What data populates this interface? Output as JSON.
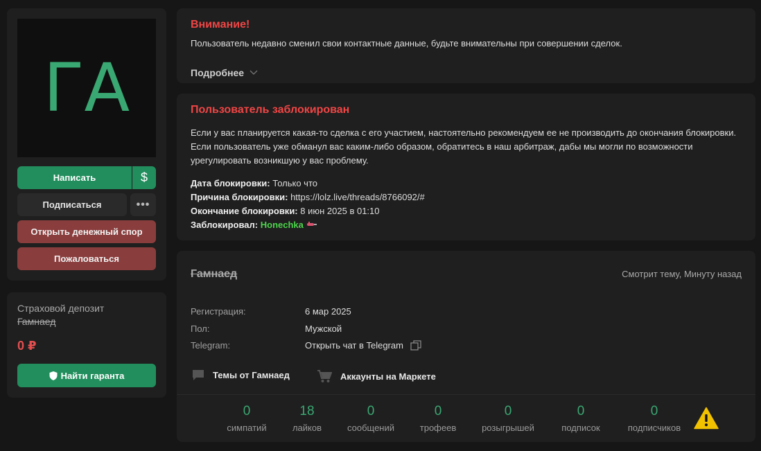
{
  "avatar": {
    "initials": "ГА",
    "color": "#3aa872"
  },
  "actions": {
    "write": "Написать",
    "money_symbol": "$",
    "follow": "Подписаться",
    "more": "•••",
    "dispute": "Открыть денежный спор",
    "report": "Пожаловаться"
  },
  "deposit": {
    "label": "Страховой депозит",
    "username": "Гамнаед",
    "amount": "0 ₽",
    "guarantor_button": "Найти гаранта"
  },
  "warning": {
    "title": "Внимание!",
    "text": "Пользователь недавно сменил свои контактные данные, будьте внимательны при совершении сделок.",
    "more": "Подробнее"
  },
  "ban": {
    "title": "Пользователь заблокирован",
    "text": "Если у вас планируется какая-то сделка с его участием, настоятельно рекомендуем ее не производить до окончания блокировки. Если пользователь уже обманул вас каким-либо образом, обратитесь в наш арбитраж, дабы мы могли по возможности урегулировать возникшую у вас проблему.",
    "date_label": "Дата блокировки:",
    "date_value": "Только что",
    "reason_label": "Причина блокировки:",
    "reason_value": "https://lolz.live/threads/8766092/#",
    "end_label": "Окончание блокировки:",
    "end_value": "8 июн 2025 в 01:10",
    "by_label": "Заблокировал:",
    "by_value": "Honechka"
  },
  "profile": {
    "username": "Гамнаед",
    "status": "Смотрит тему, Минуту назад",
    "reg_label": "Регистрация:",
    "reg_value": "6 мар 2025",
    "sex_label": "Пол:",
    "sex_value": "Мужской",
    "tg_label": "Telegram:",
    "tg_value": "Открыть чат в Telegram",
    "threads_link": "Темы от Гамнаед",
    "market_link": "Аккаунты на Маркете"
  },
  "stats": [
    {
      "value": "0",
      "label": "симпатий"
    },
    {
      "value": "18",
      "label": "лайков"
    },
    {
      "value": "0",
      "label": "сообщений"
    },
    {
      "value": "0",
      "label": "трофеев"
    },
    {
      "value": "0",
      "label": "розыгрышей"
    },
    {
      "value": "0",
      "label": "подписок"
    },
    {
      "value": "0",
      "label": "подписчиков"
    }
  ],
  "colors": {
    "accent": "#228e5d",
    "danger": "#8a3d3d",
    "alert_title": "#f04545",
    "stat": "#3aa872"
  },
  "icons": [
    "dollar-icon",
    "more-icon",
    "shield-icon",
    "chevron-down-icon",
    "copy-icon",
    "comment-icon",
    "cart-icon",
    "warning-icon"
  ]
}
